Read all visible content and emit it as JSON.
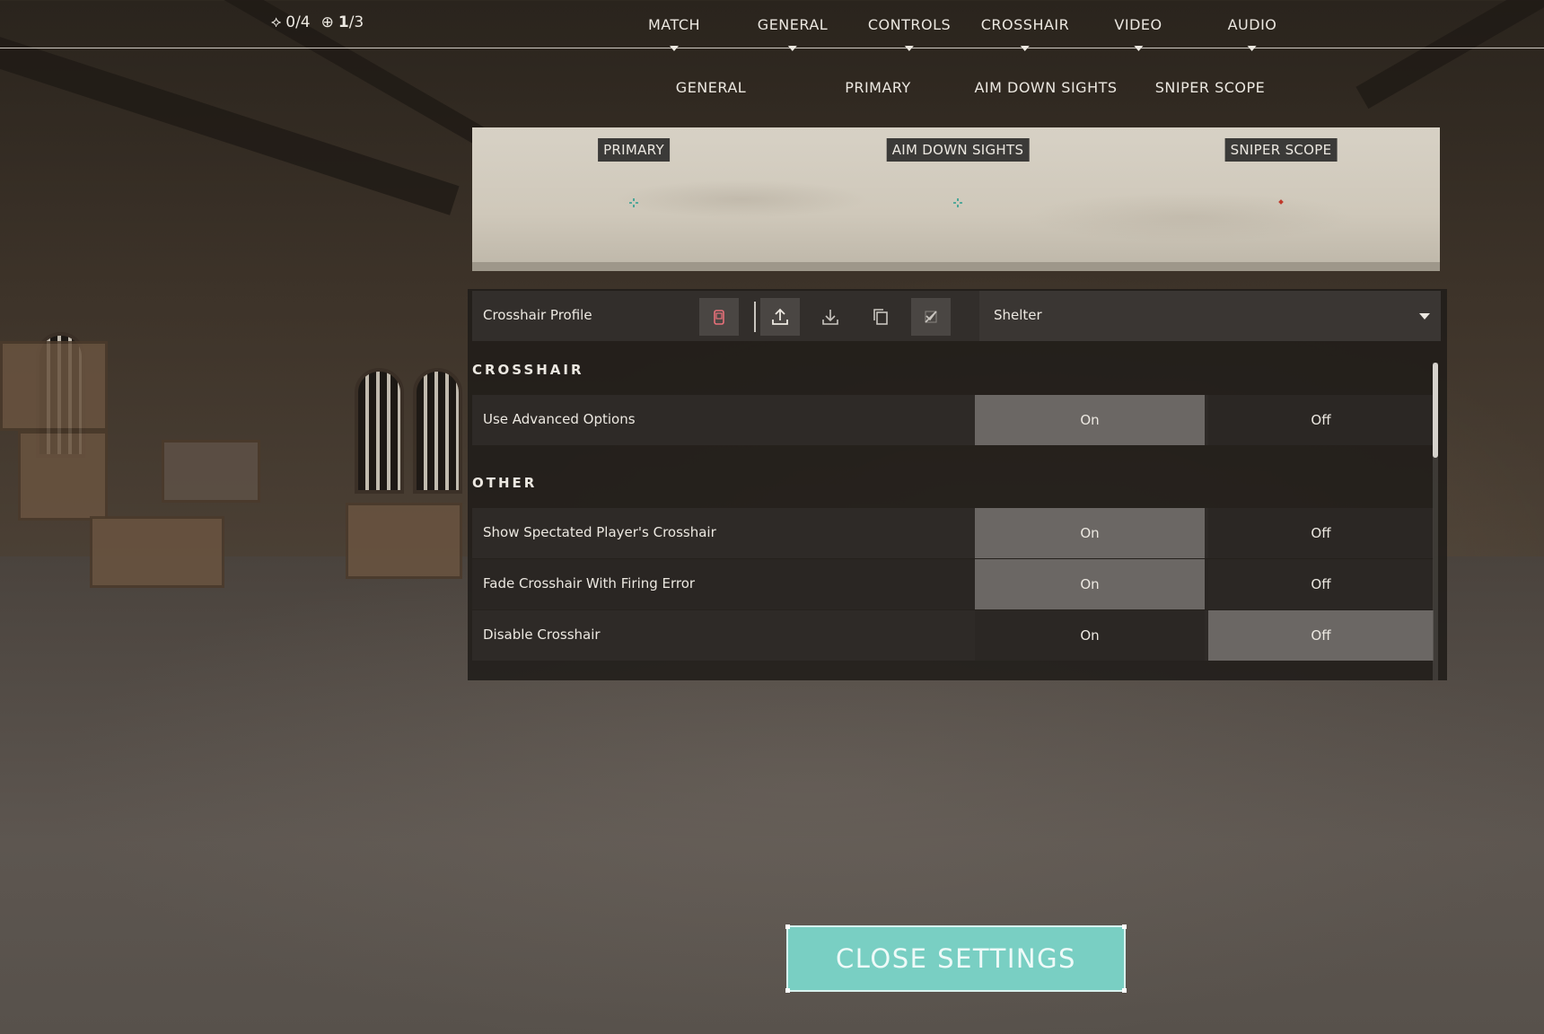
{
  "counters": [
    {
      "icon": "crosshair-diamond-icon",
      "glyph": "⟡",
      "value": "0/4"
    },
    {
      "icon": "circle-plus-icon",
      "glyph": "⊕",
      "value_bold": "1",
      "value_rest": "/3"
    }
  ],
  "main_tabs": [
    {
      "label": "MATCH"
    },
    {
      "label": "GENERAL"
    },
    {
      "label": "CONTROLS"
    },
    {
      "label": "CROSSHAIR"
    },
    {
      "label": "VIDEO"
    },
    {
      "label": "AUDIO"
    }
  ],
  "sub_tabs": [
    {
      "label": "GENERAL"
    },
    {
      "label": "PRIMARY"
    },
    {
      "label": "AIM DOWN SIGHTS"
    },
    {
      "label": "SNIPER SCOPE"
    }
  ],
  "preview": {
    "labels": [
      "PRIMARY",
      "AIM DOWN SIGHTS",
      "SNIPER SCOPE"
    ],
    "crosshair_colors": [
      "#2a9d8f",
      "#2a9d8f",
      "#c0392b"
    ]
  },
  "profile": {
    "label": "Crosshair Profile",
    "selected": "Shelter",
    "tools": [
      "delete-profile-icon",
      "import-icon",
      "export-icon",
      "copy-icon",
      "paste-disabled-icon"
    ]
  },
  "sections": {
    "crosshair_title": "CROSSHAIR",
    "other_title": "OTHER"
  },
  "options": [
    {
      "label": "Use Advanced Options",
      "on": "On",
      "off": "Off",
      "value": "On"
    },
    {
      "label": "Show Spectated Player's Crosshair",
      "on": "On",
      "off": "Off",
      "value": "On"
    },
    {
      "label": "Fade Crosshair With Firing Error",
      "on": "On",
      "off": "Off",
      "value": "On"
    },
    {
      "label": "Disable Crosshair",
      "on": "On",
      "off": "Off",
      "value": "Off"
    }
  ],
  "close_button": "CLOSE SETTINGS",
  "colors": {
    "accent": "#79cfc3",
    "selected": "#6b6764"
  }
}
